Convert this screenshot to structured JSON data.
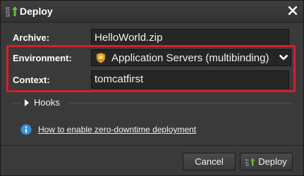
{
  "dialog": {
    "title": "Deploy",
    "icons": {
      "title": "deploy-binary-arrow-icon",
      "close": "close-icon"
    }
  },
  "form": {
    "archive": {
      "label": "Archive:",
      "value": "HelloWorld.zip"
    },
    "environment": {
      "label": "Environment:",
      "value": "Application Servers (multibinding)",
      "icon": "environment-shield-icon"
    },
    "context": {
      "label": "Context:",
      "value": "tomcatfirst"
    }
  },
  "hooks": {
    "label": "Hooks"
  },
  "info": {
    "link_text": "How to enable zero-downtime deployment"
  },
  "buttons": {
    "cancel": "Cancel",
    "deploy": "Deploy"
  },
  "colors": {
    "highlight": "#d51f2b",
    "accent_green": "#5cc23c",
    "info_blue": "#3a8fd6",
    "background": "#3a3a3a"
  }
}
